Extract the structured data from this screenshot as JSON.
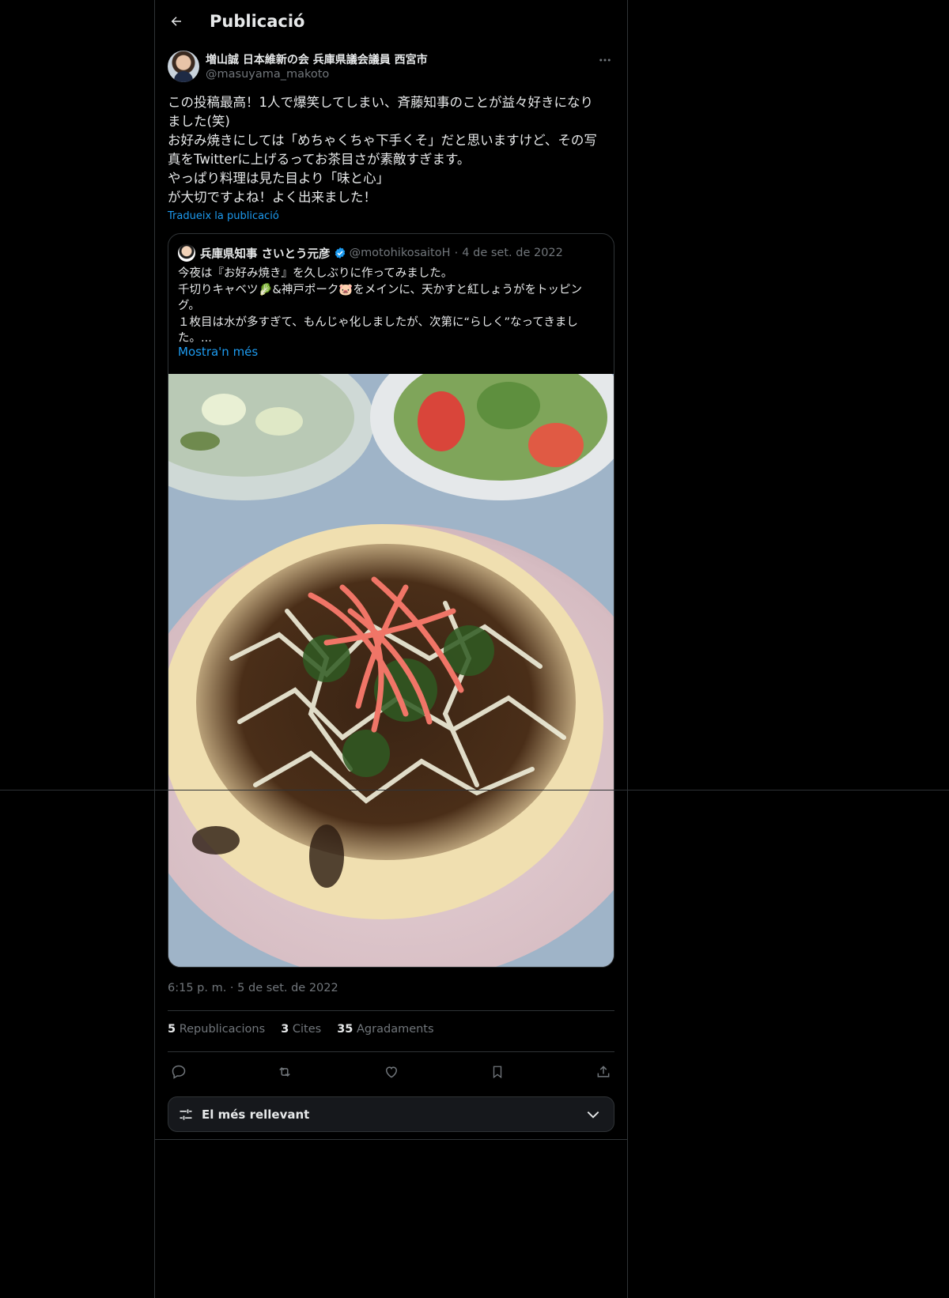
{
  "header": {
    "title": "Publicació"
  },
  "post": {
    "author_name": "増山誠 日本維新の会 兵庫県議会議員 西宮市",
    "author_handle": "@masuyama_makoto",
    "lines": [
      "この投稿最高！1人で爆笑してしまい、斉藤知事のことが益々好きになり",
      "ました(笑)",
      "お好み焼きにしては「めちゃくちゃ下手くそ」だと思いますけど、その写",
      "真をTwitterに上げるってお茶目さが素敵すぎます。",
      "やっぱり料理は見た目より「味と心」",
      "が大切ですよね！よく出来ました！"
    ],
    "translate_label": "Tradueix la publicació",
    "timestamp": "6:15 p. m. · 5 de set. de 2022"
  },
  "quote": {
    "author_name": "兵庫県知事 さいとう元彦",
    "author_handle": "@motohikosaitoH",
    "date": "4 de set. de 2022",
    "separator": "·",
    "lines": [
      "今夜は『お好み焼き』を久しぶりに作ってみました。",
      "千切りキャベツ🥬&神戸ポーク🐷をメインに、天かすと紅しょうがをトッピン",
      "グ。",
      "１枚目は水が多すぎて、もんじゃ化しましたが、次第に“らしく”なってきまし",
      "た。..."
    ],
    "show_more": "Mostra'n més"
  },
  "stats": {
    "reposts_count": "5",
    "reposts_label": "Republicacions",
    "quotes_count": "3",
    "quotes_label": "Cites",
    "likes_count": "35",
    "likes_label": "Agradaments"
  },
  "actions": [
    "reply-icon",
    "repost-icon",
    "like-icon",
    "bookmark-icon",
    "share-icon"
  ],
  "sort": {
    "label": "El més rellevant"
  },
  "colors": {
    "accent": "#1d9bf0",
    "background": "#000000",
    "muted": "#71767b",
    "text": "#e7e9ea"
  }
}
